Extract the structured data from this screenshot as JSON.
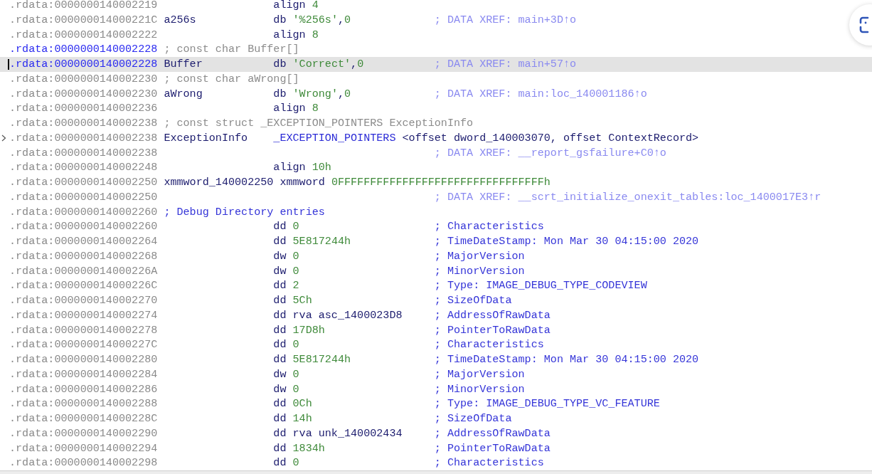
{
  "listing": {
    "rows": [
      {
        "address": ".rdata:0000000140002219",
        "highlighted": false,
        "selected": false,
        "foldable": false,
        "instruction": [
          {
            "text": "align ",
            "kind": "mnemonic"
          },
          {
            "text": "4",
            "kind": "literal"
          }
        ]
      },
      {
        "address": ".rdata:000000014000221C",
        "highlighted": false,
        "selected": false,
        "foldable": false,
        "label": "a256s",
        "instruction": [
          {
            "text": "db ",
            "kind": "mnemonic"
          },
          {
            "text": "'%256s'",
            "kind": "literal"
          },
          {
            "text": ",",
            "kind": "symbol"
          },
          {
            "text": "0",
            "kind": "literal"
          }
        ],
        "comment": {
          "text": "; DATA XREF: main+3D↑o",
          "kind": "xref"
        }
      },
      {
        "address": ".rdata:0000000140002222",
        "highlighted": false,
        "selected": false,
        "foldable": false,
        "instruction": [
          {
            "text": "align ",
            "kind": "mnemonic"
          },
          {
            "text": "8",
            "kind": "literal"
          }
        ]
      },
      {
        "address": ".rdata:0000000140002228",
        "highlighted": true,
        "selected": false,
        "foldable": false,
        "note": {
          "text": "; const char Buffer[]",
          "kind": "plain"
        }
      },
      {
        "address": ".rdata:0000000140002228",
        "highlighted": true,
        "selected": true,
        "foldable": false,
        "label": "Buffer",
        "instruction": [
          {
            "text": "db ",
            "kind": "mnemonic"
          },
          {
            "text": "'Correct'",
            "kind": "literal"
          },
          {
            "text": ",",
            "kind": "symbol"
          },
          {
            "text": "0",
            "kind": "literal"
          }
        ],
        "comment": {
          "text": "; DATA XREF: main+57↑o",
          "kind": "xref"
        }
      },
      {
        "address": ".rdata:0000000140002230",
        "highlighted": false,
        "selected": false,
        "foldable": false,
        "note": {
          "text": "; const char aWrong[]",
          "kind": "plain"
        }
      },
      {
        "address": ".rdata:0000000140002230",
        "highlighted": false,
        "selected": false,
        "foldable": false,
        "label": "aWrong",
        "instruction": [
          {
            "text": "db ",
            "kind": "mnemonic"
          },
          {
            "text": "'Wrong'",
            "kind": "literal"
          },
          {
            "text": ",",
            "kind": "symbol"
          },
          {
            "text": "0",
            "kind": "literal"
          }
        ],
        "comment": {
          "text": "; DATA XREF: main:loc_140001186↑o",
          "kind": "xref"
        }
      },
      {
        "address": ".rdata:0000000140002236",
        "highlighted": false,
        "selected": false,
        "foldable": false,
        "instruction": [
          {
            "text": "align ",
            "kind": "mnemonic"
          },
          {
            "text": "8",
            "kind": "literal"
          }
        ]
      },
      {
        "address": ".rdata:0000000140002238",
        "highlighted": false,
        "selected": false,
        "foldable": false,
        "note": {
          "text": "; const struct _EXCEPTION_POINTERS ExceptionInfo",
          "kind": "plain"
        }
      },
      {
        "address": ".rdata:0000000140002238",
        "highlighted": false,
        "selected": false,
        "foldable": true,
        "label": "ExceptionInfo",
        "instruction": [
          {
            "text": "_EXCEPTION_POINTERS",
            "kind": "type"
          },
          {
            "text": " <offset dword_140003070, offset ContextRecord>",
            "kind": "symbol"
          }
        ]
      },
      {
        "address": ".rdata:0000000140002238",
        "highlighted": false,
        "selected": false,
        "foldable": false,
        "comment": {
          "text": "; DATA XREF: __report_gsfailure+C0↑o",
          "kind": "xref"
        }
      },
      {
        "address": ".rdata:0000000140002248",
        "highlighted": false,
        "selected": false,
        "foldable": false,
        "instruction": [
          {
            "text": "align ",
            "kind": "mnemonic"
          },
          {
            "text": "10h",
            "kind": "literal"
          }
        ]
      },
      {
        "address": ".rdata:0000000140002250",
        "highlighted": false,
        "selected": false,
        "foldable": false,
        "label": "xmmword_140002250",
        "instruction": [
          {
            "text": "xmmword ",
            "kind": "mnemonic"
          },
          {
            "text": "0FFFFFFFFFFFFFFFFFFFFFFFFFFFFFFFFh",
            "kind": "literal"
          }
        ]
      },
      {
        "address": ".rdata:0000000140002250",
        "highlighted": false,
        "selected": false,
        "foldable": false,
        "comment": {
          "text": "; DATA XREF: __scrt_initialize_onexit_tables:loc_1400017E3↑r",
          "kind": "xref"
        }
      },
      {
        "address": ".rdata:0000000140002260",
        "highlighted": false,
        "selected": false,
        "foldable": false,
        "note": {
          "text": "; Debug Directory entries",
          "kind": "auto"
        }
      },
      {
        "address": ".rdata:0000000140002260",
        "highlighted": false,
        "selected": false,
        "foldable": false,
        "instruction": [
          {
            "text": "dd ",
            "kind": "mnemonic"
          },
          {
            "text": "0",
            "kind": "literal"
          }
        ],
        "comment": {
          "text": "; Characteristics",
          "kind": "auto"
        }
      },
      {
        "address": ".rdata:0000000140002264",
        "highlighted": false,
        "selected": false,
        "foldable": false,
        "instruction": [
          {
            "text": "dd ",
            "kind": "mnemonic"
          },
          {
            "text": "5E817244h",
            "kind": "literal"
          }
        ],
        "comment": {
          "text": "; TimeDateStamp: Mon Mar 30 04:15:00 2020",
          "kind": "auto"
        }
      },
      {
        "address": ".rdata:0000000140002268",
        "highlighted": false,
        "selected": false,
        "foldable": false,
        "instruction": [
          {
            "text": "dw ",
            "kind": "mnemonic"
          },
          {
            "text": "0",
            "kind": "literal"
          }
        ],
        "comment": {
          "text": "; MajorVersion",
          "kind": "auto"
        }
      },
      {
        "address": ".rdata:000000014000226A",
        "highlighted": false,
        "selected": false,
        "foldable": false,
        "instruction": [
          {
            "text": "dw ",
            "kind": "mnemonic"
          },
          {
            "text": "0",
            "kind": "literal"
          }
        ],
        "comment": {
          "text": "; MinorVersion",
          "kind": "auto"
        }
      },
      {
        "address": ".rdata:000000014000226C",
        "highlighted": false,
        "selected": false,
        "foldable": false,
        "instruction": [
          {
            "text": "dd ",
            "kind": "mnemonic"
          },
          {
            "text": "2",
            "kind": "literal"
          }
        ],
        "comment": {
          "text": "; Type: IMAGE_DEBUG_TYPE_CODEVIEW",
          "kind": "auto"
        }
      },
      {
        "address": ".rdata:0000000140002270",
        "highlighted": false,
        "selected": false,
        "foldable": false,
        "instruction": [
          {
            "text": "dd ",
            "kind": "mnemonic"
          },
          {
            "text": "5Ch",
            "kind": "literal"
          }
        ],
        "comment": {
          "text": "; SizeOfData",
          "kind": "auto"
        }
      },
      {
        "address": ".rdata:0000000140002274",
        "highlighted": false,
        "selected": false,
        "foldable": false,
        "instruction": [
          {
            "text": "dd rva asc_1400023D8",
            "kind": "mnemonic"
          }
        ],
        "comment": {
          "text": "; AddressOfRawData",
          "kind": "auto"
        }
      },
      {
        "address": ".rdata:0000000140002278",
        "highlighted": false,
        "selected": false,
        "foldable": false,
        "instruction": [
          {
            "text": "dd ",
            "kind": "mnemonic"
          },
          {
            "text": "17D8h",
            "kind": "literal"
          }
        ],
        "comment": {
          "text": "; PointerToRawData",
          "kind": "auto"
        }
      },
      {
        "address": ".rdata:000000014000227C",
        "highlighted": false,
        "selected": false,
        "foldable": false,
        "instruction": [
          {
            "text": "dd ",
            "kind": "mnemonic"
          },
          {
            "text": "0",
            "kind": "literal"
          }
        ],
        "comment": {
          "text": "; Characteristics",
          "kind": "auto"
        }
      },
      {
        "address": ".rdata:0000000140002280",
        "highlighted": false,
        "selected": false,
        "foldable": false,
        "instruction": [
          {
            "text": "dd ",
            "kind": "mnemonic"
          },
          {
            "text": "5E817244h",
            "kind": "literal"
          }
        ],
        "comment": {
          "text": "; TimeDateStamp: Mon Mar 30 04:15:00 2020",
          "kind": "auto"
        }
      },
      {
        "address": ".rdata:0000000140002284",
        "highlighted": false,
        "selected": false,
        "foldable": false,
        "instruction": [
          {
            "text": "dw ",
            "kind": "mnemonic"
          },
          {
            "text": "0",
            "kind": "literal"
          }
        ],
        "comment": {
          "text": "; MajorVersion",
          "kind": "auto"
        }
      },
      {
        "address": ".rdata:0000000140002286",
        "highlighted": false,
        "selected": false,
        "foldable": false,
        "instruction": [
          {
            "text": "dw ",
            "kind": "mnemonic"
          },
          {
            "text": "0",
            "kind": "literal"
          }
        ],
        "comment": {
          "text": "; MinorVersion",
          "kind": "auto"
        }
      },
      {
        "address": ".rdata:0000000140002288",
        "highlighted": false,
        "selected": false,
        "foldable": false,
        "instruction": [
          {
            "text": "dd ",
            "kind": "mnemonic"
          },
          {
            "text": "0Ch",
            "kind": "literal"
          }
        ],
        "comment": {
          "text": "; Type: IMAGE_DEBUG_TYPE_VC_FEATURE",
          "kind": "auto"
        }
      },
      {
        "address": ".rdata:000000014000228C",
        "highlighted": false,
        "selected": false,
        "foldable": false,
        "instruction": [
          {
            "text": "dd ",
            "kind": "mnemonic"
          },
          {
            "text": "14h",
            "kind": "literal"
          }
        ],
        "comment": {
          "text": "; SizeOfData",
          "kind": "auto"
        }
      },
      {
        "address": ".rdata:0000000140002290",
        "highlighted": false,
        "selected": false,
        "foldable": false,
        "instruction": [
          {
            "text": "dd rva unk_140002434",
            "kind": "mnemonic"
          }
        ],
        "comment": {
          "text": "; AddressOfRawData",
          "kind": "auto"
        }
      },
      {
        "address": ".rdata:0000000140002294",
        "highlighted": false,
        "selected": false,
        "foldable": false,
        "instruction": [
          {
            "text": "dd ",
            "kind": "mnemonic"
          },
          {
            "text": "1834h",
            "kind": "literal"
          }
        ],
        "comment": {
          "text": "; PointerToRawData",
          "kind": "auto"
        }
      },
      {
        "address": ".rdata:0000000140002298",
        "highlighted": false,
        "selected": false,
        "foldable": false,
        "instruction": [
          {
            "text": "dd ",
            "kind": "mnemonic"
          },
          {
            "text": "0",
            "kind": "literal"
          }
        ],
        "comment": {
          "text": "; Characteristics",
          "kind": "auto"
        }
      }
    ]
  }
}
